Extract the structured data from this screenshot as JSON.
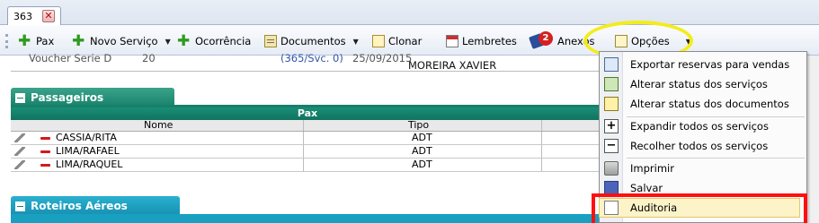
{
  "tab": {
    "label": "363"
  },
  "toolbar": {
    "pax": "Pax",
    "novo_servico": "Novo Serviço",
    "ocorrencia": "Ocorrência",
    "documentos": "Documentos",
    "clonar": "Clonar",
    "lembretes": "Lembretes",
    "anexos": "Anexos",
    "anexos_count": "2",
    "opcoes": "Opções"
  },
  "background_row": {
    "service": "Voucher Serie D",
    "qty": "20",
    "code": "(365/Svc. 0)",
    "date": "25/09/2015",
    "name": "MOREIRA XAVIER"
  },
  "passageiros": {
    "title": "Passageiros",
    "group_header": "Pax",
    "columns": [
      "Nome",
      "Tipo"
    ],
    "rows": [
      {
        "nome": "CASSIA/RITA",
        "tipo": "ADT"
      },
      {
        "nome": "LIMA/RAFAEL",
        "tipo": "ADT"
      },
      {
        "nome": "LIMA/RAQUEL",
        "tipo": "ADT"
      }
    ]
  },
  "roteiros": {
    "title": "Roteiros Aéreos"
  },
  "menu": {
    "items": [
      {
        "label": "Exportar reservas para vendas",
        "icon": "export-icon"
      },
      {
        "label": "Alterar status dos serviços",
        "icon": "status-services-icon"
      },
      {
        "label": "Alterar status dos documentos",
        "icon": "status-documents-icon"
      },
      {
        "label": "Expandir todos os serviços",
        "icon": "expand-icon"
      },
      {
        "label": "Recolher todos os serviços",
        "icon": "collapse-icon"
      },
      {
        "label": "Imprimir",
        "icon": "printer-icon"
      },
      {
        "label": "Salvar",
        "icon": "save-icon"
      },
      {
        "label": "Auditoria",
        "icon": "audit-icon"
      }
    ]
  },
  "colors": {
    "panel_green": "#17806a",
    "highlight_yellow": "#f4ec1a",
    "highlight_red": "#ff1010",
    "roteiros_blue": "#19a0c0"
  }
}
